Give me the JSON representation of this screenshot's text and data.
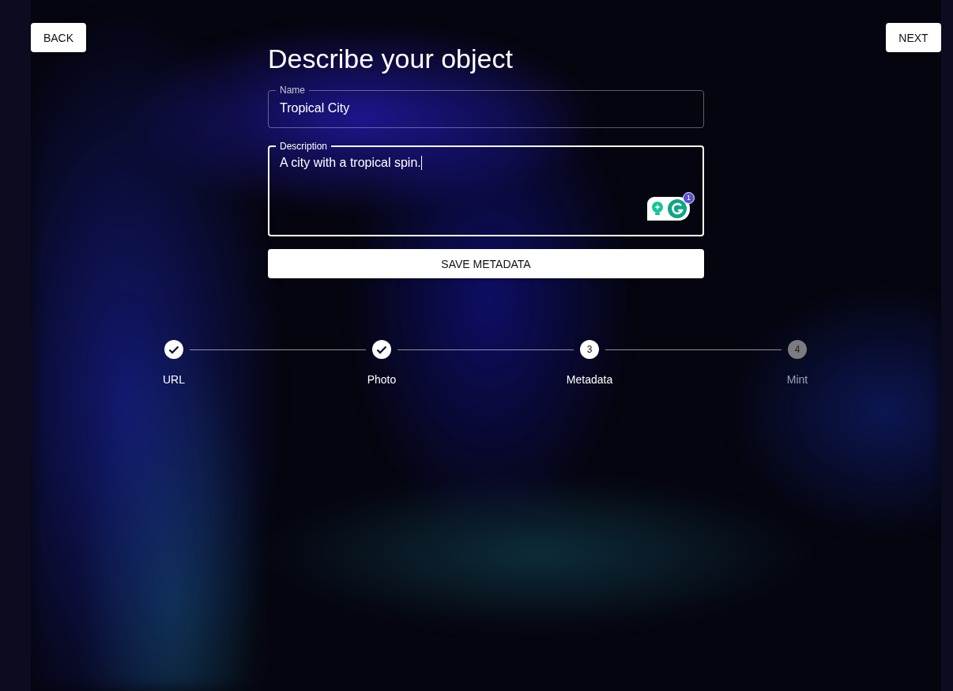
{
  "nav": {
    "back": "BACK",
    "next": "NEXT"
  },
  "title": "Describe your object",
  "form": {
    "name": {
      "label": "Name",
      "value": "Tropical City",
      "focused": false
    },
    "description": {
      "label": "Description",
      "value": "A city with a tropical spin.",
      "focused": true
    },
    "assistant_badge": "1",
    "save": "SAVE METADATA"
  },
  "steps": [
    {
      "label": "URL",
      "kind": "completed"
    },
    {
      "label": "Photo",
      "kind": "completed"
    },
    {
      "label": "Metadata",
      "number": "3",
      "kind": "active"
    },
    {
      "label": "Mint",
      "number": "4",
      "kind": "pending"
    }
  ]
}
